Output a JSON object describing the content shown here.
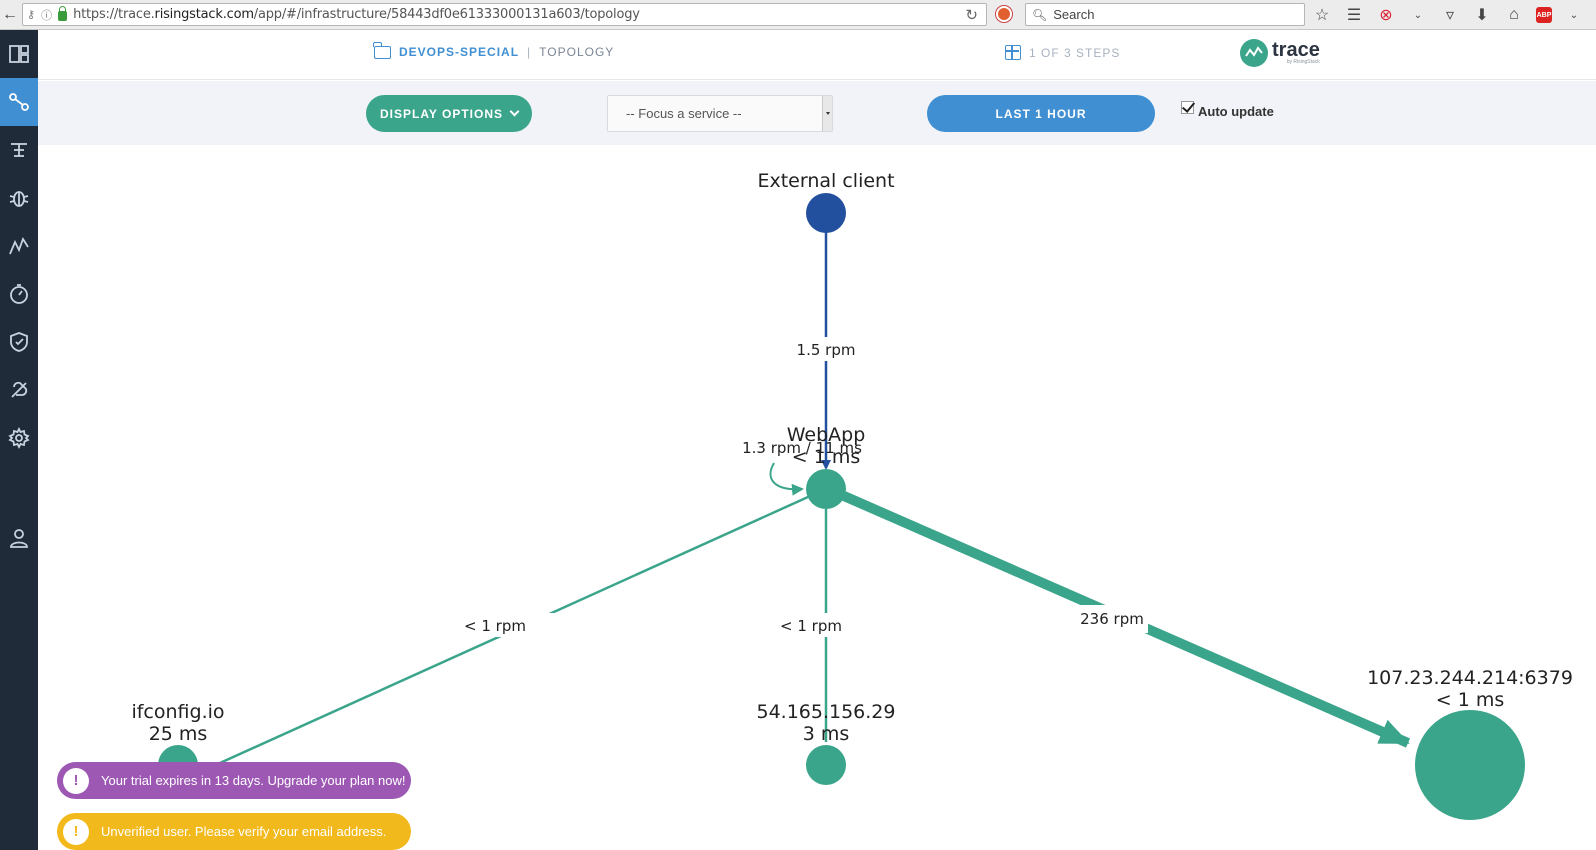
{
  "browser": {
    "url_prefix": "https://trace.",
    "url_domain": "risingstack.com",
    "url_rest": "/app/#/infrastructure/58443df0e61333000131a603/topology",
    "search_placeholder": "Search",
    "abp_label": "ABP"
  },
  "header": {
    "project": "DEVOPS-SPECIAL",
    "separator": "|",
    "page": "TOPOLOGY",
    "steps": "1 OF 3 STEPS",
    "logo_text": "trace",
    "logo_sub": "by RisingStack"
  },
  "controls": {
    "display_options": "DISPLAY OPTIONS",
    "focus_placeholder": "-- Focus a service --",
    "time_range": "LAST 1 HOUR",
    "auto_update_label": "Auto update",
    "auto_update_checked": true
  },
  "sidebar": {
    "items": [
      {
        "icon": "dashboard-icon",
        "active": false
      },
      {
        "icon": "topology-icon",
        "active": true
      },
      {
        "icon": "trace-icon",
        "active": false
      },
      {
        "icon": "bug-icon",
        "active": false
      },
      {
        "icon": "metrics-icon",
        "active": false
      },
      {
        "icon": "stopwatch-icon",
        "active": false
      },
      {
        "icon": "shield-icon",
        "active": false
      },
      {
        "icon": "alert-icon",
        "active": false
      },
      {
        "icon": "gear-icon",
        "active": false
      },
      {
        "icon": "user-icon",
        "active": false
      }
    ]
  },
  "topology": {
    "nodes": [
      {
        "id": "external",
        "name": "External client",
        "latency": "",
        "color": "#23509e"
      },
      {
        "id": "webapp",
        "name": "WebApp",
        "latency": "< 1 ms",
        "color": "#3aa58b"
      },
      {
        "id": "ifconfig",
        "name": "ifconfig.io",
        "latency": "25 ms",
        "color": "#3aa58b"
      },
      {
        "id": "ip54",
        "name": "54.165.156.29",
        "latency": "3 ms",
        "color": "#3aa58b"
      },
      {
        "id": "redis",
        "name": "107.23.244.214:6379",
        "latency": "< 1 ms",
        "color": "#3aa58b"
      }
    ],
    "edges": [
      {
        "from": "external",
        "to": "webapp",
        "label": "1.5 rpm"
      },
      {
        "from": "webapp",
        "to": "webapp",
        "label": "1.3 rpm / 11 ms"
      },
      {
        "from": "webapp",
        "to": "ifconfig",
        "label": "< 1 rpm"
      },
      {
        "from": "webapp",
        "to": "ip54",
        "label": "< 1 rpm"
      },
      {
        "from": "webapp",
        "to": "redis",
        "label": "236 rpm"
      }
    ]
  },
  "toasts": {
    "trial": "Your trial expires in 13 days. Upgrade your plan now!",
    "verify": "Unverified user. Please verify your email address.",
    "icon_glyph": "!"
  }
}
